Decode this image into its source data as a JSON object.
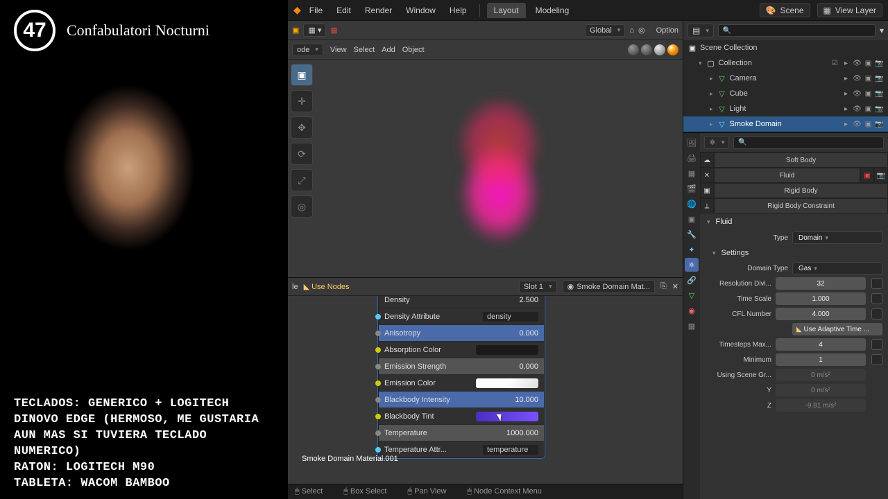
{
  "overlay": {
    "channel": "Confabulatori Nocturni",
    "logo_text": "47",
    "info_text": "TECLADOS: GENERICO + LOGITECH DINOVO EDGE (HERMOSO, ME GUSTARIA AUN MAS SI TUVIERA TECLADO NUMERICO)\nRATON: LOGITECH M90\nTABLETA: WACOM BAMBOO"
  },
  "topbar": {
    "menus": [
      "File",
      "Edit",
      "Render",
      "Window",
      "Help"
    ],
    "workspaces": [
      "Layout",
      "Modeling"
    ],
    "active_workspace": "Layout",
    "scene_label": "Scene",
    "viewlayer_label": "View Layer"
  },
  "viewport_header": {
    "orientation": "Global",
    "option_label": "Option"
  },
  "viewport_toolbar": {
    "mode_partial": "ode",
    "menus": [
      "View",
      "Select",
      "Add",
      "Object"
    ]
  },
  "node_editor": {
    "header_partial": "le",
    "use_nodes": "Use Nodes",
    "slot": "Slot 1",
    "material": "Smoke Domain Mat...",
    "footer_text": "Smoke Domain Material.001",
    "node": {
      "rows": [
        {
          "type": "hdr",
          "label": "Density",
          "value": "2.500"
        },
        {
          "type": "attr",
          "label": "Density Attribute",
          "value": "density",
          "sk": "sk-c"
        },
        {
          "type": "slider",
          "label": "Anisotropy",
          "value": "0.000",
          "sk": "sk-g",
          "blue": true
        },
        {
          "type": "color",
          "label": "Absorption Color",
          "color": "#1a1a1a",
          "sk": "sk-y"
        },
        {
          "type": "slider",
          "label": "Emission Strength",
          "value": "0.000",
          "sk": "sk-g"
        },
        {
          "type": "color",
          "label": "Emission Color",
          "color": "linear-gradient(135deg,#fff 0%,#fff 50%,#ddd 100%)",
          "sk": "sk-y"
        },
        {
          "type": "slider",
          "label": "Blackbody Intensity",
          "value": "10.000",
          "sk": "sk-g",
          "blue": true
        },
        {
          "type": "color",
          "label": "Blackbody Tint",
          "color": "linear-gradient(90deg,#4a30c0,#7a50ff)",
          "sk": "sk-y",
          "cursor": true
        },
        {
          "type": "slider",
          "label": "Temperature",
          "value": "1000.000",
          "sk": "sk-g"
        },
        {
          "type": "attr",
          "label": "Temperature Attr...",
          "value": "temperature",
          "sk": "sk-c"
        }
      ]
    }
  },
  "statusbar": {
    "items": [
      "Select",
      "Box Select",
      "Pan View",
      "Node Context Menu"
    ]
  },
  "outliner": {
    "root": "Scene Collection",
    "collection": "Collection",
    "items": [
      {
        "name": "Camera",
        "color": "#6c6"
      },
      {
        "name": "Cube",
        "color": "#6c6"
      },
      {
        "name": "Light",
        "color": "#6c6"
      },
      {
        "name": "Smoke Domain",
        "color": "#7cf",
        "selected": true
      }
    ]
  },
  "properties": {
    "truncated_top": "Soft Body",
    "modifiers": [
      "Fluid",
      "Rigid Body",
      "Rigid Body Constraint"
    ],
    "panel": "Fluid",
    "type_label": "Type",
    "type_value": "Domain",
    "settings_label": "Settings",
    "rows": [
      {
        "label": "Domain Type",
        "value": "Gas",
        "kind": "dd"
      },
      {
        "label": "Resolution Divi...",
        "value": "32",
        "kind": "num"
      },
      {
        "label": "Time Scale",
        "value": "1.000",
        "kind": "num"
      },
      {
        "label": "CFL Number",
        "value": "4.000",
        "kind": "num"
      },
      {
        "label": "",
        "value": "Use Adaptive Time ...",
        "kind": "toggle"
      },
      {
        "label": "Timesteps Max...",
        "value": "4",
        "kind": "num"
      },
      {
        "label": "Minimum",
        "value": "1",
        "kind": "num"
      },
      {
        "label": "Using Scene Gr...",
        "value": "0 m/s²",
        "kind": "dim"
      },
      {
        "label": "Y",
        "value": "0 m/s²",
        "kind": "dim"
      },
      {
        "label": "Z",
        "value": "-9.81 m/s²",
        "kind": "dim"
      }
    ]
  }
}
